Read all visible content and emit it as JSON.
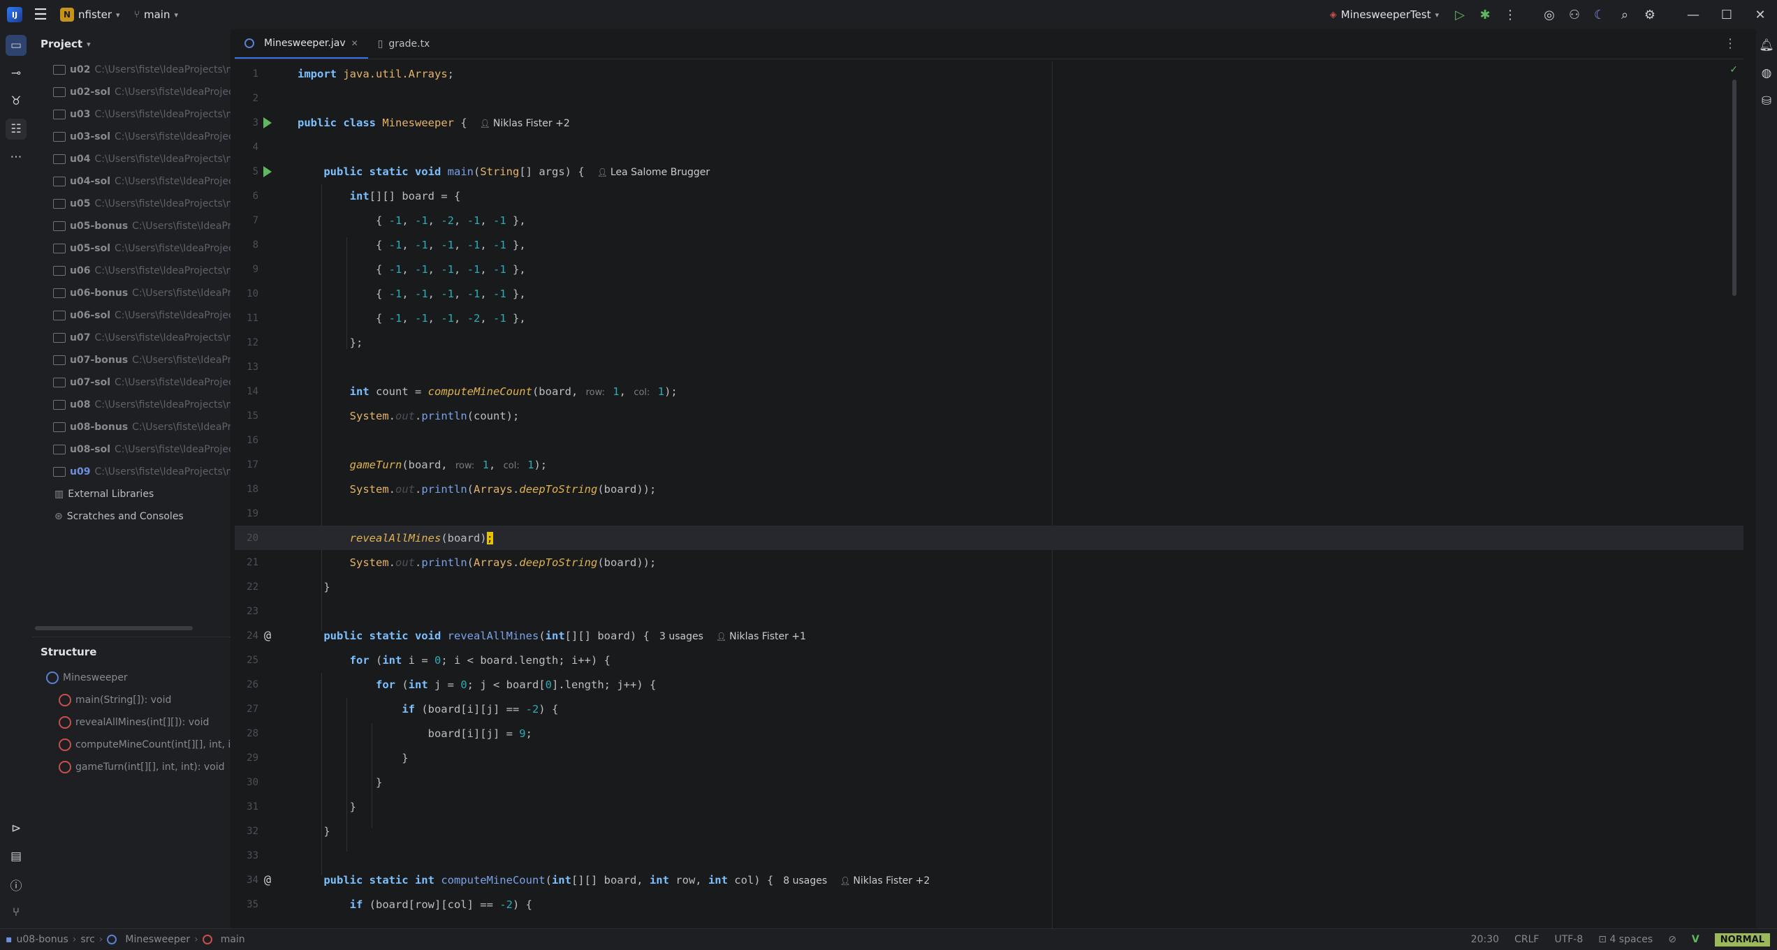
{
  "titlebar": {
    "project_badge": "N",
    "project_name": "nfister",
    "branch": "main",
    "run_config": "MinesweeperTest"
  },
  "project_panel": {
    "title": "Project",
    "items": [
      {
        "name": "u02",
        "path": "C:\\Users\\fiste\\IdeaProjects\\nfis"
      },
      {
        "name": "u02-sol",
        "path": "C:\\Users\\fiste\\IdeaProjects\\"
      },
      {
        "name": "u03",
        "path": "C:\\Users\\fiste\\IdeaProjects\\nfis"
      },
      {
        "name": "u03-sol",
        "path": "C:\\Users\\fiste\\IdeaProjects\\"
      },
      {
        "name": "u04",
        "path": "C:\\Users\\fiste\\IdeaProjects\\nfis"
      },
      {
        "name": "u04-sol",
        "path": "C:\\Users\\fiste\\IdeaProjects\\"
      },
      {
        "name": "u05",
        "path": "C:\\Users\\fiste\\IdeaProjects\\nfis"
      },
      {
        "name": "u05-bonus",
        "path": "C:\\Users\\fiste\\IdeaProjec"
      },
      {
        "name": "u05-sol",
        "path": "C:\\Users\\fiste\\IdeaProjects\\"
      },
      {
        "name": "u06",
        "path": "C:\\Users\\fiste\\IdeaProjects\\nfis"
      },
      {
        "name": "u06-bonus",
        "path": "C:\\Users\\fiste\\IdeaProjec"
      },
      {
        "name": "u06-sol",
        "path": "C:\\Users\\fiste\\IdeaProjects\\"
      },
      {
        "name": "u07",
        "path": "C:\\Users\\fiste\\IdeaProjects\\nfis"
      },
      {
        "name": "u07-bonus",
        "path": "C:\\Users\\fiste\\IdeaProjec"
      },
      {
        "name": "u07-sol",
        "path": "C:\\Users\\fiste\\IdeaProjects\\"
      },
      {
        "name": "u08",
        "path": "C:\\Users\\fiste\\IdeaProjects\\nfis"
      },
      {
        "name": "u08-bonus",
        "path": "C:\\Users\\fiste\\IdeaProjec"
      },
      {
        "name": "u08-sol",
        "path": "C:\\Users\\fiste\\IdeaProjects\\"
      },
      {
        "name": "u09",
        "path": "C:\\Users\\fiste\\IdeaProjects\\nfis"
      }
    ],
    "external_libraries": "External Libraries",
    "scratches": "Scratches and Consoles"
  },
  "structure_panel": {
    "title": "Structure",
    "class_name": "Minesweeper",
    "members": [
      "main(String[]): void",
      "revealAllMines(int[][]): void",
      "computeMineCount(int[][], int, in",
      "gameTurn(int[][], int, int): void"
    ]
  },
  "editor": {
    "tabs": [
      {
        "label": "Minesweeper.jav"
      },
      {
        "label": "grade.tx"
      }
    ],
    "authors": {
      "class": "Niklas Fister +2",
      "main": "Lea Salome Brugger",
      "reveal": "Niklas Fister +1",
      "compute": "Niklas Fister +2"
    },
    "usages": {
      "reveal": "3 usages",
      "compute": "8 usages"
    },
    "hints": {
      "row": "row:",
      "col": "col:"
    }
  },
  "statusbar": {
    "breadcrumbs": [
      "u08-bonus",
      "src",
      "Minesweeper",
      "main"
    ],
    "position": "20:30",
    "line_ending": "CRLF",
    "encoding": "UTF-8",
    "indent": "4 spaces",
    "mode": "NORMAL"
  },
  "colors": {
    "accent": "#3574f0",
    "run_green": "#5fb85f",
    "caret": "#e6c200"
  }
}
